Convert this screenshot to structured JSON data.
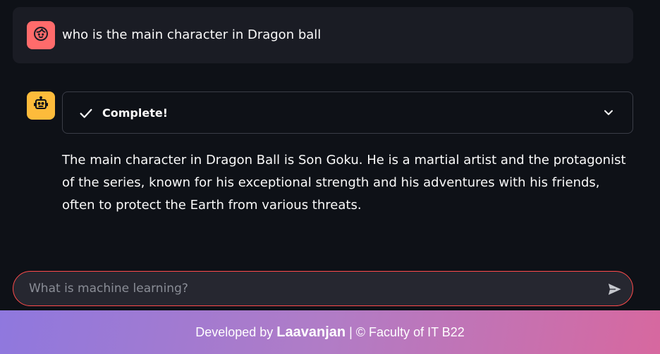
{
  "user_message": {
    "avatar_icon": "face-icon",
    "text": "who is the main character in Dragon ball"
  },
  "assistant": {
    "avatar_icon": "robot-icon",
    "status": {
      "label": "Complete!",
      "icon": "check-icon",
      "expand_icon": "chevron-down-icon"
    },
    "response": "The main character in Dragon Ball is Son Goku. He is a martial artist and the protagonist of the series, known for his exceptional strength and his adventures with his friends, often to protect the Earth from various threats."
  },
  "chat_input": {
    "placeholder": "What is machine learning?",
    "value": "",
    "send_icon": "send-icon"
  },
  "footer": {
    "prefix": "Developed by ",
    "author": "Laavanjan",
    "suffix": " | © Faculty of IT B22"
  },
  "colors": {
    "background": "#0e1117",
    "user_avatar": "#ff6b6b",
    "bot_avatar": "#fdbb3b",
    "input_border": "#ff4b4b",
    "footer_gradient_start": "#8f78de",
    "footer_gradient_end": "#d7689f"
  }
}
